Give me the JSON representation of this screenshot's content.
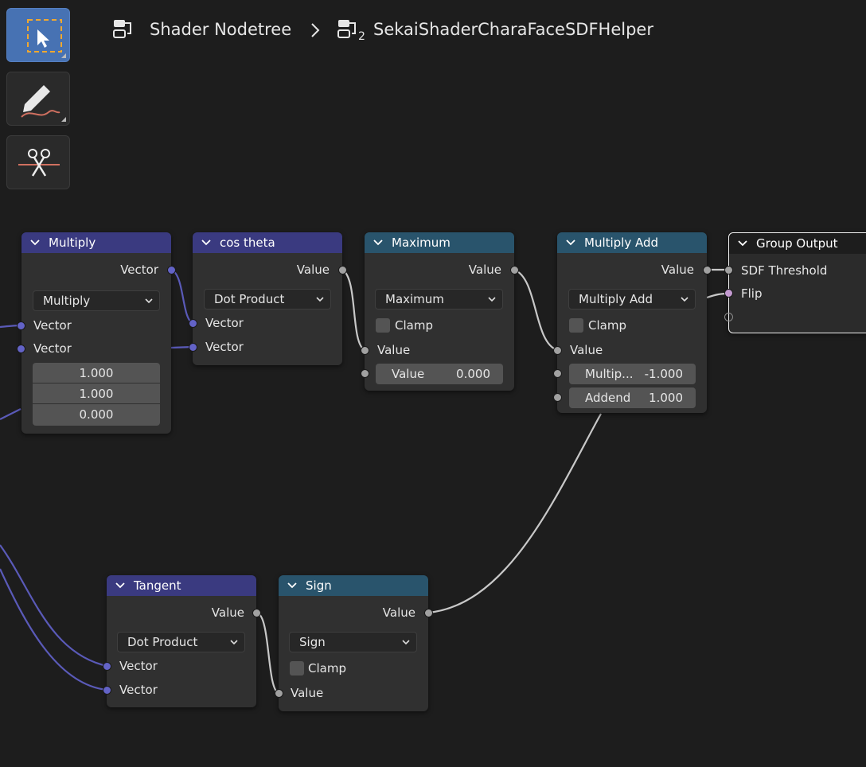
{
  "toolbar": {
    "tools": [
      {
        "name": "select-box",
        "active": true
      },
      {
        "name": "annotate",
        "active": false
      },
      {
        "name": "links-cut",
        "active": false
      }
    ]
  },
  "breadcrumb": {
    "items": [
      "Shader Nodetree",
      "SekaiShaderCharaFaceSDFHelper"
    ],
    "group_level": "2"
  },
  "colors": {
    "background": "#1d1d1d",
    "vector_header": "#3a3a80",
    "converter_header": "#29546c",
    "vector_socket": "#6363c7",
    "value_socket": "#a1a1a1",
    "link_value": "#c8c8c8"
  },
  "nodes": {
    "multiply": {
      "title": "Multiply",
      "output": "Vector",
      "operation": "Multiply",
      "inputs": [
        "Vector",
        "Vector"
      ],
      "values": [
        "1.000",
        "1.000",
        "0.000"
      ]
    },
    "cos_theta": {
      "title": "cos theta",
      "output": "Value",
      "operation": "Dot Product",
      "inputs": [
        "Vector",
        "Vector"
      ]
    },
    "maximum": {
      "title": "Maximum",
      "output": "Value",
      "operation": "Maximum",
      "clamp": "Clamp",
      "input": "Value",
      "field_label": "Value",
      "field_value": "0.000"
    },
    "multiply_add": {
      "title": "Multiply Add",
      "output": "Value",
      "operation": "Multiply Add",
      "clamp": "Clamp",
      "input": "Value",
      "multiplier_label": "Multip...",
      "multiplier_value": "-1.000",
      "addend_label": "Addend",
      "addend_value": "1.000"
    },
    "group_output": {
      "title": "Group Output",
      "inputs": [
        "SDF Threshold",
        "Flip"
      ]
    },
    "tangent": {
      "title": "Tangent",
      "output": "Value",
      "operation": "Dot Product",
      "inputs": [
        "Vector",
        "Vector"
      ]
    },
    "sign": {
      "title": "Sign",
      "output": "Value",
      "operation": "Sign",
      "clamp": "Clamp",
      "input": "Value"
    }
  }
}
